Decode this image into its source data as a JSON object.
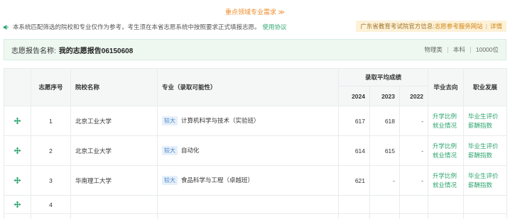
{
  "top_link": "重点领域专业需求 ≫",
  "notice": {
    "text": "本系统匹配筛选的院校和专业仅作为参考，考生须在本省志愿系统中按照要求正式填报志愿。",
    "link": "使用协议"
  },
  "official": {
    "prefix": "广东省教育考试院官方信息:",
    "link1": "志愿参考服务网站",
    "separator": "|",
    "link2": "详情"
  },
  "report": {
    "label": "志愿报告名称:",
    "name": "我的志愿报告06150608",
    "subject": "物理类",
    "level": "本科",
    "rank": "10000位"
  },
  "table": {
    "headers": {
      "order": "志愿序号",
      "school": "院校名称",
      "major": "专业（录取可能性）",
      "avg_score": "录取平均成绩",
      "year1": "2024",
      "year2": "2023",
      "year3": "2022",
      "destination": "毕业去向",
      "career": "职业发展"
    },
    "rows": [
      {
        "order": "1",
        "school": "北京工业大学",
        "tag": "较大",
        "major": "计算机科学与技术（实验班）",
        "s2024": "617",
        "s2023": "618",
        "s2022": "-",
        "dest1": "升学比例",
        "dest2": "就业情况",
        "car1": "毕业生评价",
        "car2": "薪酬指数"
      },
      {
        "order": "2",
        "school": "北京工业大学",
        "tag": "较大",
        "major": "自动化",
        "s2024": "614",
        "s2023": "615",
        "s2022": "-",
        "dest1": "升学比例",
        "dest2": "就业情况",
        "car1": "毕业生评价",
        "car2": "薪酬指数"
      },
      {
        "order": "3",
        "school": "华南理工大学",
        "tag": "较大",
        "major": "食品科学与工程（卓越班）",
        "s2024": "621",
        "s2023": "-",
        "s2022": "-",
        "dest1": "升学比例",
        "dest2": "就业情况",
        "car1": "毕业生评价",
        "car2": "薪酬指数"
      },
      {
        "order": "4"
      }
    ]
  }
}
